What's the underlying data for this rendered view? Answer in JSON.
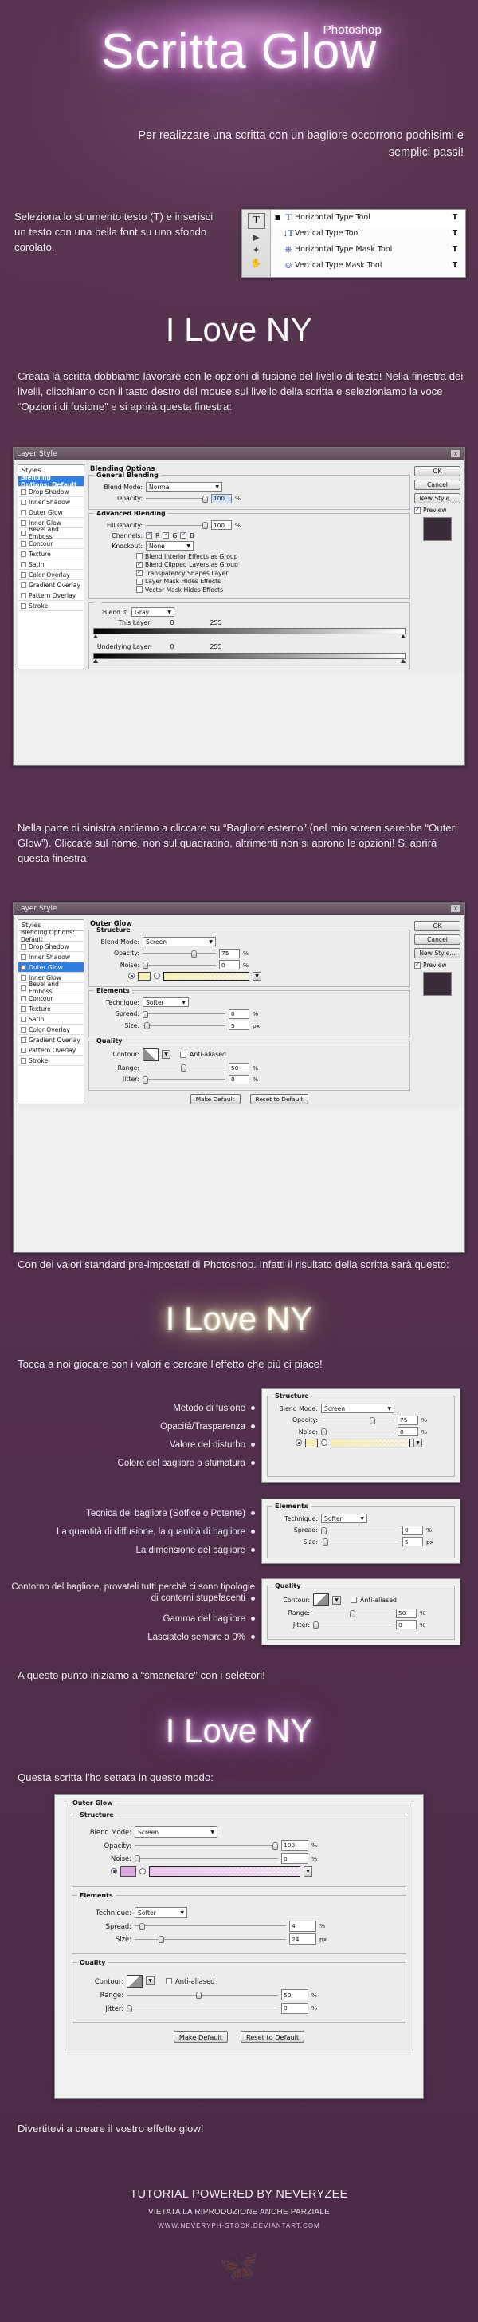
{
  "header": {
    "title": "Scritta Glow",
    "superscript": "Photoshop",
    "subtitle": "Per realizzare una scritta con un bagliore occorrono pochisimi e semplici passi!"
  },
  "step1": {
    "text": "Seleziona lo strumento testo (T) e inserisci un testo con una bella font su uno sfondo corolato.",
    "toolbar": {
      "active_tool_glyph": "T",
      "side_icons": [
        "pointer-icon",
        "lasso-icon",
        "hand-icon"
      ],
      "items": [
        {
          "bullet": "■",
          "glyph": "T",
          "label": "Horizontal Type Tool",
          "key": "T"
        },
        {
          "bullet": "",
          "glyph": "↓T",
          "label": "Vertical Type Tool",
          "key": "T"
        },
        {
          "bullet": "",
          "glyph": "⎈",
          "label": "Horizontal Type Mask Tool",
          "key": "T"
        },
        {
          "bullet": "",
          "glyph": "⎉",
          "label": "Vertical Type Mask Tool",
          "key": "T"
        }
      ]
    }
  },
  "sample1": "I Love NY",
  "step2": {
    "text": "Creata la scritta dobbiamo lavorare con le opzioni di fusione del livello di testo! Nella finestra dei livelli, clicchiamo con il tasto destro del mouse sul livello della scritta e selezioniamo la voce “Opzioni di fusione” e si aprirà questa finestra:"
  },
  "dialog1": {
    "window_title": "Layer Style",
    "close_label": "x",
    "styles_header": "Styles",
    "styles": [
      {
        "label": "Blending Options: Default",
        "selected": true,
        "checkbox": false
      },
      {
        "label": "Drop Shadow",
        "selected": false,
        "checkbox": true
      },
      {
        "label": "Inner Shadow",
        "selected": false,
        "checkbox": true
      },
      {
        "label": "Outer Glow",
        "selected": false,
        "checkbox": true
      },
      {
        "label": "Inner Glow",
        "selected": false,
        "checkbox": true
      },
      {
        "label": "Bevel and Emboss",
        "selected": false,
        "checkbox": true
      },
      {
        "label": "Contour",
        "selected": false,
        "checkbox": true
      },
      {
        "label": "Texture",
        "selected": false,
        "checkbox": true
      },
      {
        "label": "Satin",
        "selected": false,
        "checkbox": true
      },
      {
        "label": "Color Overlay",
        "selected": false,
        "checkbox": true
      },
      {
        "label": "Gradient Overlay",
        "selected": false,
        "checkbox": true
      },
      {
        "label": "Pattern Overlay",
        "selected": false,
        "checkbox": true
      },
      {
        "label": "Stroke",
        "selected": false,
        "checkbox": true
      }
    ],
    "section_title": "Blending Options",
    "general": {
      "title": "General Blending",
      "blend_mode_label": "Blend Mode:",
      "blend_mode_value": "Normal",
      "opacity_label": "Opacity:",
      "opacity_value": "100",
      "pct": "%"
    },
    "advanced": {
      "title": "Advanced Blending",
      "fill_opacity_label": "Fill Opacity:",
      "fill_opacity_value": "100",
      "channels_label": "Channels:",
      "channels": [
        {
          "label": "R",
          "checked": true
        },
        {
          "label": "G",
          "checked": true
        },
        {
          "label": "B",
          "checked": true
        }
      ],
      "knockout_label": "Knockout:",
      "knockout_value": "None",
      "options": [
        {
          "label": "Blend Interior Effects as Group",
          "checked": false
        },
        {
          "label": "Blend Clipped Layers as Group",
          "checked": true
        },
        {
          "label": "Transparency Shapes Layer",
          "checked": true
        },
        {
          "label": "Layer Mask Hides Effects",
          "checked": false
        },
        {
          "label": "Vector Mask Hides Effects",
          "checked": false
        }
      ]
    },
    "blend_if": {
      "label": "Blend If:",
      "value": "Gray",
      "this_layer_label": "This Layer:",
      "this_layer_min": "0",
      "this_layer_max": "255",
      "underlying_label": "Underlying Layer:",
      "underlying_min": "0",
      "underlying_max": "255"
    },
    "buttons": {
      "ok": "OK",
      "cancel": "Cancel",
      "new_style": "New Style...",
      "preview": "Preview"
    }
  },
  "step3": {
    "text": "Nella parte di sinistra andiamo a cliccare su “Bagliore esterno” (nel mio screen sarebbe “Outer Glow”). Cliccate sul nome, non sul quadratino, altrimenti non si aprono le opzioni! Si aprirà questa finestra:"
  },
  "dialog2": {
    "window_title": "Layer Style",
    "close_label": "x",
    "styles_header": "Styles",
    "styles": [
      {
        "label": "Blending Options: Default",
        "selected": false,
        "checkbox": false
      },
      {
        "label": "Drop Shadow",
        "selected": false,
        "checkbox": true
      },
      {
        "label": "Inner Shadow",
        "selected": false,
        "checkbox": true
      },
      {
        "label": "Outer Glow",
        "selected": true,
        "checkbox": true
      },
      {
        "label": "Inner Glow",
        "selected": false,
        "checkbox": true
      },
      {
        "label": "Bevel and Emboss",
        "selected": false,
        "checkbox": true
      },
      {
        "label": "Contour",
        "selected": false,
        "checkbox": true
      },
      {
        "label": "Texture",
        "selected": false,
        "checkbox": true
      },
      {
        "label": "Satin",
        "selected": false,
        "checkbox": true
      },
      {
        "label": "Color Overlay",
        "selected": false,
        "checkbox": true
      },
      {
        "label": "Gradient Overlay",
        "selected": false,
        "checkbox": true
      },
      {
        "label": "Pattern Overlay",
        "selected": false,
        "checkbox": true
      },
      {
        "label": "Stroke",
        "selected": false,
        "checkbox": true
      }
    ],
    "section_title": "Outer Glow",
    "structure": {
      "title": "Structure",
      "blend_mode_label": "Blend Mode:",
      "blend_mode_value": "Screen",
      "opacity_label": "Opacity:",
      "opacity_value": "75",
      "noise_label": "Noise:",
      "noise_value": "0",
      "pct": "%",
      "color_hex": "#f6f0b8"
    },
    "elements": {
      "title": "Elements",
      "technique_label": "Technique:",
      "technique_value": "Softer",
      "spread_label": "Spread:",
      "spread_value": "0",
      "spread_unit": "%",
      "size_label": "Size:",
      "size_value": "5",
      "size_unit": "px"
    },
    "quality": {
      "title": "Quality",
      "contour_label": "Contour:",
      "anti_aliased_label": "Anti-aliased",
      "anti_aliased_checked": false,
      "range_label": "Range:",
      "range_value": "50",
      "range_unit": "%",
      "jitter_label": "Jitter:",
      "jitter_value": "0",
      "jitter_unit": "%"
    },
    "footer_buttons": {
      "make_default": "Make Default",
      "reset_to_default": "Reset to Default"
    },
    "buttons": {
      "ok": "OK",
      "cancel": "Cancel",
      "new_style": "New Style...",
      "preview": "Preview"
    }
  },
  "step4": {
    "text": "Con dei valori standard pre-impostati di Photoshop. Infatti il risultato della scritta sarà questo:"
  },
  "sample2": "I Love NY",
  "step5": {
    "text": "Tocca a noi giocare con i valori e cercare l'effetto che più ci piace!"
  },
  "annot_structure": {
    "callouts": [
      "Metodo di fusione",
      "Opacità/Trasparenza",
      "Valore del disturbo",
      "Colore del bagliore o sfumatura"
    ],
    "panel": {
      "title": "Structure",
      "blend_mode_label": "Blend Mode:",
      "blend_mode_value": "Screen",
      "opacity_label": "Opacity:",
      "opacity_value": "75",
      "noise_label": "Noise:",
      "noise_value": "0",
      "pct": "%"
    }
  },
  "annot_elements": {
    "callouts": [
      "Tecnica del bagliore (Soffice o Potente)",
      "La quantità di diffusione, la quantità di bagliore",
      "La dimensione del bagliore"
    ],
    "panel": {
      "title": "Elements",
      "technique_label": "Technique:",
      "technique_value": "Softer",
      "spread_label": "Spread:",
      "spread_value": "0",
      "spread_unit": "%",
      "size_label": "Size:",
      "size_value": "5",
      "size_unit": "px"
    }
  },
  "annot_quality": {
    "callouts": [
      "Contorno del bagliore, provateli tutti perchè ci sono tipologie di contorni stupefacenti",
      "Gamma del bagliore",
      "Lasciatelo sempre a 0%"
    ],
    "panel": {
      "title": "Quality",
      "contour_label": "Contour:",
      "anti_aliased_label": "Anti-aliased",
      "range_label": "Range:",
      "range_value": "50",
      "range_unit": "%",
      "jitter_label": "Jitter:",
      "jitter_value": "0",
      "jitter_unit": "%"
    }
  },
  "step6": {
    "text": "A questo punto iniziamo a “smanetare” con i selettori!"
  },
  "sample3": "I Love NY",
  "step7": {
    "text": "Questa scritta l'ho settata in questo modo:"
  },
  "dialog3": {
    "section_title": "Outer Glow",
    "structure": {
      "title": "Structure",
      "blend_mode_label": "Blend Mode:",
      "blend_mode_value": "Screen",
      "opacity_label": "Opacity:",
      "opacity_value": "100",
      "noise_label": "Noise:",
      "noise_value": "0",
      "pct": "%",
      "color_hex": "#d9a8dd"
    },
    "elements": {
      "title": "Elements",
      "technique_label": "Technique:",
      "technique_value": "Softer",
      "spread_label": "Spread:",
      "spread_value": "4",
      "spread_unit": "%",
      "size_label": "Size:",
      "size_value": "24",
      "size_unit": "px"
    },
    "quality": {
      "title": "Quality",
      "contour_label": "Contour:",
      "anti_aliased_label": "Anti-aliased",
      "range_label": "Range:",
      "range_value": "50",
      "range_unit": "%",
      "jitter_label": "Jitter:",
      "jitter_value": "0",
      "jitter_unit": "%"
    },
    "footer_buttons": {
      "make_default": "Make Default",
      "reset_to_default": "Reset to Default"
    }
  },
  "closing": {
    "text": "Divertitevi a creare il vostro effetto glow!"
  },
  "footer": {
    "line1": "TUTORIAL POWERED BY NEVERYZEE",
    "line2": "VIETATA LA RIPRODUZIONE ANCHE PARZIALE",
    "line3": "WWW.NEVERYPH-STOCK.DEVIANTART.COM",
    "butterfly": "butterfly-icon"
  }
}
